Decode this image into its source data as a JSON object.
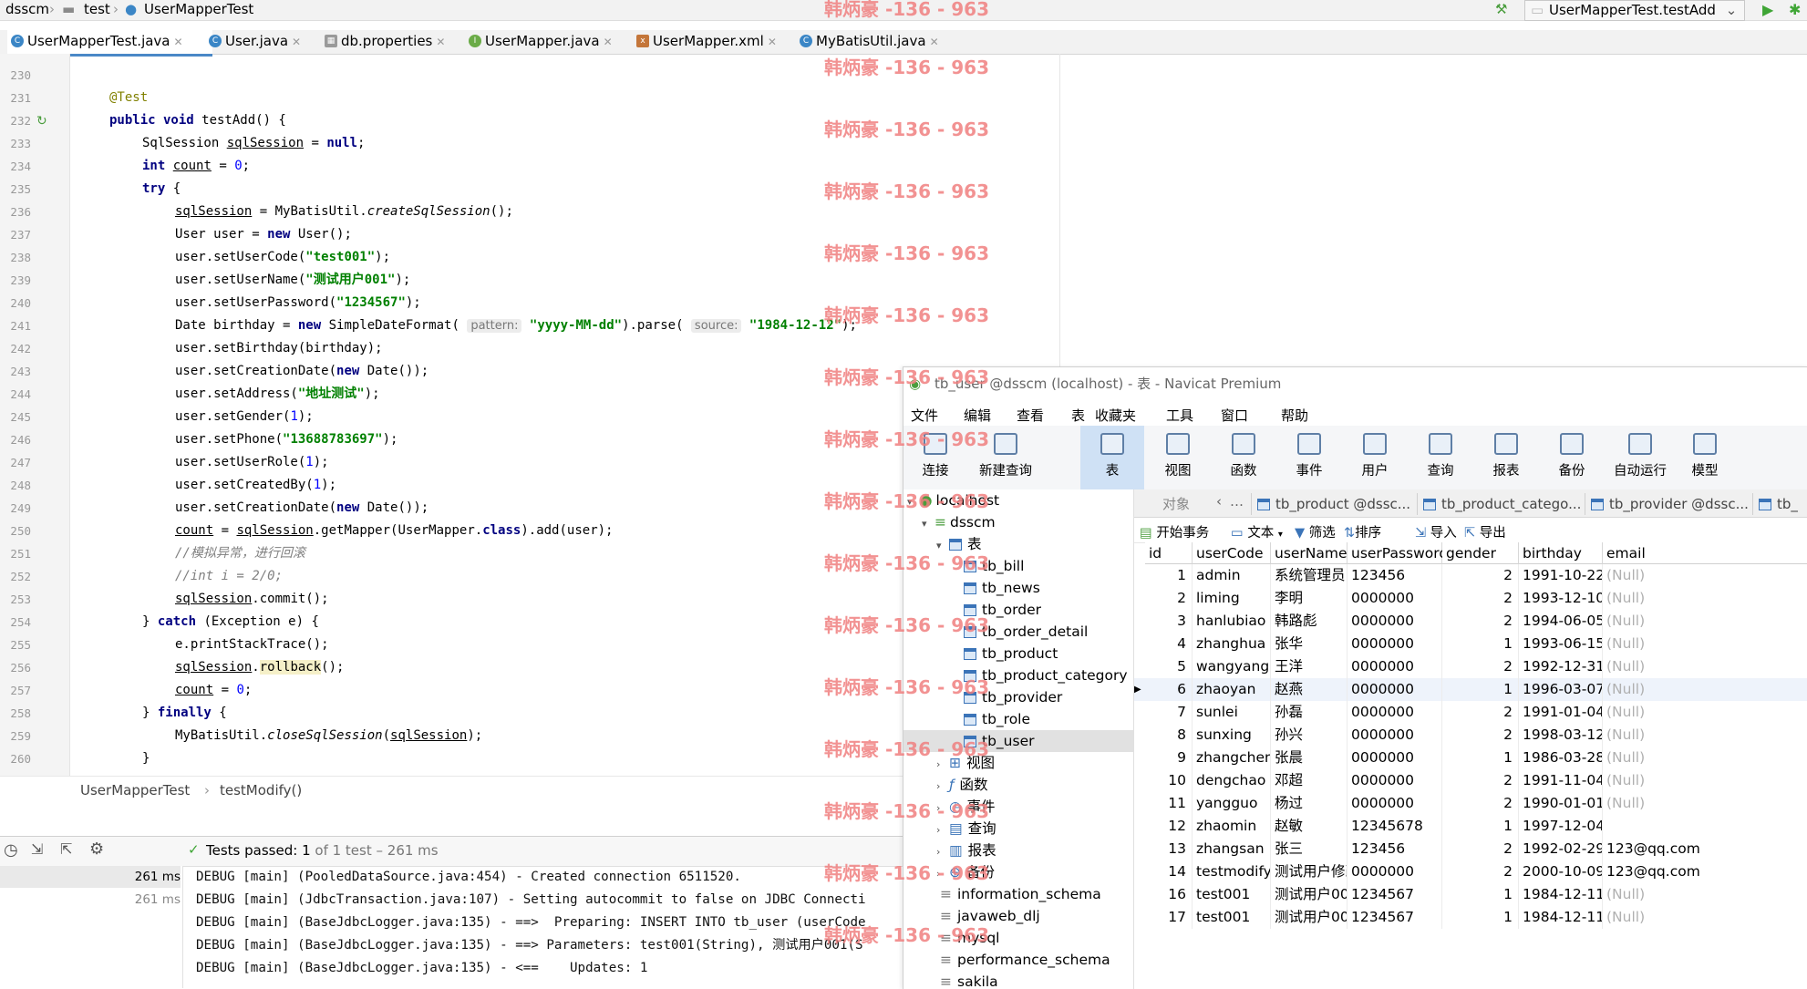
{
  "ide": {
    "breadcrumb": [
      "dsscm",
      "test",
      "UserMapperTest"
    ],
    "run_config": "UserMapperTest.testAdd",
    "tabs": [
      {
        "label": "UserMapperTest.java",
        "active": true
      },
      {
        "label": "User.java"
      },
      {
        "label": "db.properties"
      },
      {
        "label": "UserMapper.java"
      },
      {
        "label": "UserMapper.xml"
      },
      {
        "label": "MyBatisUtil.java"
      }
    ],
    "line_numbers": [
      "230",
      "231",
      "232",
      "233",
      "234",
      "235",
      "236",
      "237",
      "238",
      "239",
      "240",
      "241",
      "242",
      "243",
      "244",
      "245",
      "246",
      "247",
      "248",
      "249",
      "250",
      "251",
      "252",
      "253",
      "254",
      "255",
      "256",
      "257",
      "258",
      "259",
      "260"
    ],
    "editor_breadcrumb": {
      "class": "UserMapperTest",
      "method": "testModify()"
    },
    "test_status": {
      "passed": "Tests passed:",
      "count": "1",
      "of": "of 1 test",
      "time": "– 261 ms"
    },
    "test_tree": [
      "261 ms",
      "261 ms"
    ],
    "console": [
      "DEBUG [main] (PooledDataSource.java:454) - Created connection 6511520.",
      "DEBUG [main] (JdbcTransaction.java:107) - Setting autocommit to false on JDBC Connecti",
      "DEBUG [main] (BaseJdbcLogger.java:135) - ==>  Preparing: INSERT INTO tb_user (userCode",
      "DEBUG [main] (BaseJdbcLogger.java:135) - ==> Parameters: test001(String), 测试用户001(S",
      "DEBUG [main] (BaseJdbcLogger.java:135) - <==    Updates: 1"
    ]
  },
  "watermark": "韩炳豪 -136 - 963",
  "navicat": {
    "title": "tb_user @dsscm (localhost) - 表 - Navicat Premium",
    "menu": [
      "文件",
      "编辑",
      "查看",
      "表",
      "收藏夹",
      "工具",
      "窗口",
      "帮助"
    ],
    "toolbar": [
      "连接",
      "新建查询",
      "表",
      "视图",
      "函数",
      "事件",
      "用户",
      "查询",
      "报表",
      "备份",
      "自动运行",
      "模型"
    ],
    "tree": {
      "server": "localhost",
      "db": "dsscm",
      "tables_label": "表",
      "tables": [
        "tb_bill",
        "tb_news",
        "tb_order",
        "tb_order_detail",
        "tb_product",
        "tb_product_category",
        "tb_provider",
        "tb_role",
        "tb_user"
      ],
      "groups": [
        "视图",
        "函数",
        "事件",
        "查询",
        "报表",
        "备份"
      ],
      "other_dbs": [
        "information_schema",
        "javaweb_dlj",
        "mysql",
        "performance_schema",
        "sakila"
      ]
    },
    "object_tabs": [
      "对象",
      "tb_product @dssc...",
      "tb_product_catego...",
      "tb_provider @dssc...",
      "tb_"
    ],
    "grid_toolbar": [
      "开始事务",
      "文本",
      "筛选",
      "排序",
      "导入",
      "导出"
    ],
    "columns": [
      "id",
      "userCode",
      "userName",
      "userPassword",
      "gender",
      "birthday",
      "email"
    ],
    "rows": [
      [
        "1",
        "admin",
        "系统管理员",
        "123456",
        "2",
        "1991-10-22",
        "(Null)"
      ],
      [
        "2",
        "liming",
        "李明",
        "0000000",
        "2",
        "1993-12-10",
        "(Null)"
      ],
      [
        "3",
        "hanlubiao",
        "韩路彪",
        "0000000",
        "2",
        "1994-06-05",
        "(Null)"
      ],
      [
        "4",
        "zhanghua",
        "张华",
        "0000000",
        "1",
        "1993-06-15",
        "(Null)"
      ],
      [
        "5",
        "wangyang",
        "王洋",
        "0000000",
        "2",
        "1992-12-31",
        "(Null)"
      ],
      [
        "6",
        "zhaoyan",
        "赵燕",
        "0000000",
        "1",
        "1996-03-07",
        "(Null)"
      ],
      [
        "7",
        "sunlei",
        "孙磊",
        "0000000",
        "2",
        "1991-01-04",
        "(Null)"
      ],
      [
        "8",
        "sunxing",
        "孙兴",
        "0000000",
        "2",
        "1998-03-12",
        "(Null)"
      ],
      [
        "9",
        "zhangchen",
        "张晨",
        "0000000",
        "1",
        "1986-03-28",
        "(Null)"
      ],
      [
        "10",
        "dengchao",
        "邓超",
        "0000000",
        "2",
        "1991-11-04",
        "(Null)"
      ],
      [
        "11",
        "yangguo",
        "杨过",
        "0000000",
        "2",
        "1990-01-01",
        "(Null)"
      ],
      [
        "12",
        "zhaomin",
        "赵敏",
        "12345678",
        "1",
        "1997-12-04",
        ""
      ],
      [
        "13",
        "zhangsan",
        "张三",
        "123456",
        "2",
        "1992-02-29",
        "123@qq.com"
      ],
      [
        "14",
        "testmodify",
        "测试用户修改",
        "0000000",
        "2",
        "2000-10-09",
        "123@qq.com"
      ],
      [
        "16",
        "test001",
        "测试用户001",
        "1234567",
        "1",
        "1984-12-11",
        "(Null)"
      ],
      [
        "17",
        "test001",
        "测试用户001",
        "1234567",
        "1",
        "1984-12-11",
        "(Null)"
      ]
    ]
  }
}
